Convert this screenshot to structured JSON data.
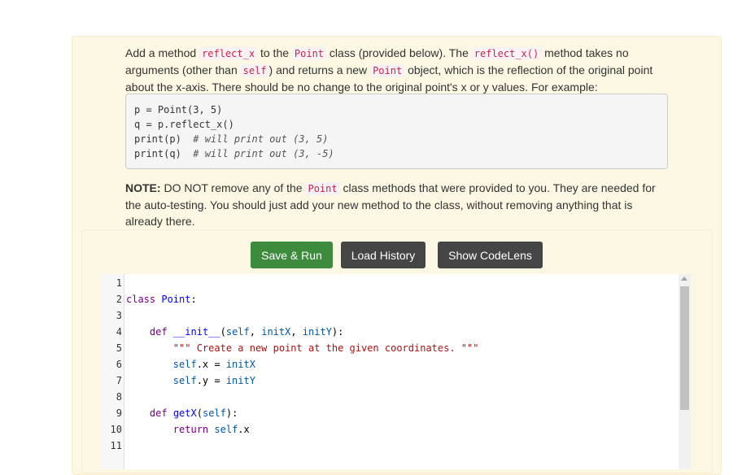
{
  "description": {
    "t1": "Add a method ",
    "c1": "reflect_x",
    "t2": " to the ",
    "c2": "Point",
    "t3": " class (provided below). The ",
    "c3": "reflect_x()",
    "t4": " method takes no arguments (other than ",
    "c4": "self",
    "t5": ") and returns a new ",
    "c5": "Point",
    "t6": " object, which is the reflection of the original point about the x-axis. There should be no change to the original point's x or y values. For example:"
  },
  "example": {
    "l1": "p = Point(3, 5)",
    "l2": "q = p.reflect_x()",
    "l3_code": "print(p)  ",
    "l3_comment": "# will print out (3, 5)",
    "l4_code": "print(q)  ",
    "l4_comment": "# will print out (3, -5)"
  },
  "note": {
    "bold": "NOTE:",
    "t1": " DO NOT remove any of the ",
    "code": "Point",
    "t2": " class methods that were provided to you. They are needed for the auto-testing. You should just add your new method to the class, without removing anything that is already there."
  },
  "buttons": {
    "save_run": "Save & Run",
    "load_history": "Load History",
    "show_codelens": "Show CodeLens"
  },
  "editor": {
    "line_numbers": [
      "1",
      "2",
      "3",
      "4",
      "5",
      "6",
      "7",
      "8",
      "9",
      "10",
      "11"
    ],
    "l2_kw": "class",
    "l2_name": "Point",
    "l2_end": ":",
    "l4_indent": "    ",
    "l4_kw": "def",
    "l4_name": "__init__",
    "l4_p1": "(",
    "l4_self": "self",
    "l4_c1": ", ",
    "l4_a1": "initX",
    "l4_c2": ", ",
    "l4_a2": "initY",
    "l4_end": "):",
    "l5_indent": "        ",
    "l5_str": "\"\"\" Create a new point at the given coordinates. \"\"\"",
    "l6_indent": "        ",
    "l6_self": "self",
    "l6_rest": ".x = ",
    "l6_val": "initX",
    "l7_indent": "        ",
    "l7_self": "self",
    "l7_rest": ".y = ",
    "l7_val": "initY",
    "l9_indent": "    ",
    "l9_kw": "def",
    "l9_name": "getX",
    "l9_p1": "(",
    "l9_self": "self",
    "l9_end": "):",
    "l10_indent": "        ",
    "l10_kw": "return",
    "l10_sp": " ",
    "l10_self": "self",
    "l10_rest": ".x"
  }
}
